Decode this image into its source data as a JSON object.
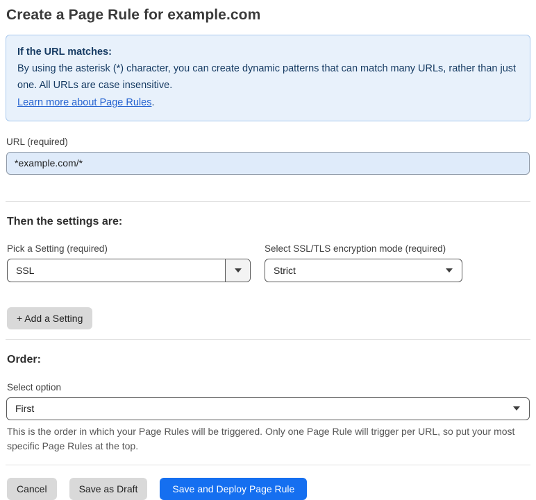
{
  "page": {
    "title": "Create a Page Rule for example.com"
  },
  "info_box": {
    "heading": "If the URL matches:",
    "body": "By using the asterisk (*) character, you can create dynamic patterns that can match many URLs, rather than just one. All URLs are case insensitive.",
    "link_label": "Learn more about Page Rules",
    "link_suffix": "."
  },
  "url_field": {
    "label": "URL (required)",
    "value": "*example.com/*"
  },
  "settings_section": {
    "heading": "Then the settings are:",
    "setting_select": {
      "label": "Pick a Setting (required)",
      "value": "SSL"
    },
    "mode_select": {
      "label": "Select SSL/TLS encryption mode (required)",
      "value": "Strict"
    },
    "add_setting_label": "+ Add a Setting"
  },
  "order_section": {
    "heading": "Order:",
    "select_label": "Select option",
    "select_value": "First",
    "helper_text": "This is the order in which your Page Rules will be triggered. Only one Page Rule will trigger per URL, so put your most specific Page Rules at the top."
  },
  "footer": {
    "cancel_label": "Cancel",
    "save_draft_label": "Save as Draft",
    "save_deploy_label": "Save and Deploy Page Rule"
  },
  "colors": {
    "accent_blue": "#156ff0",
    "info_bg": "#e8f1fb",
    "info_border": "#a9c9ee",
    "info_text": "#163b63",
    "link_blue": "#2563d0",
    "input_bg": "#dfebfa",
    "gray_button": "#d9d9d9"
  }
}
